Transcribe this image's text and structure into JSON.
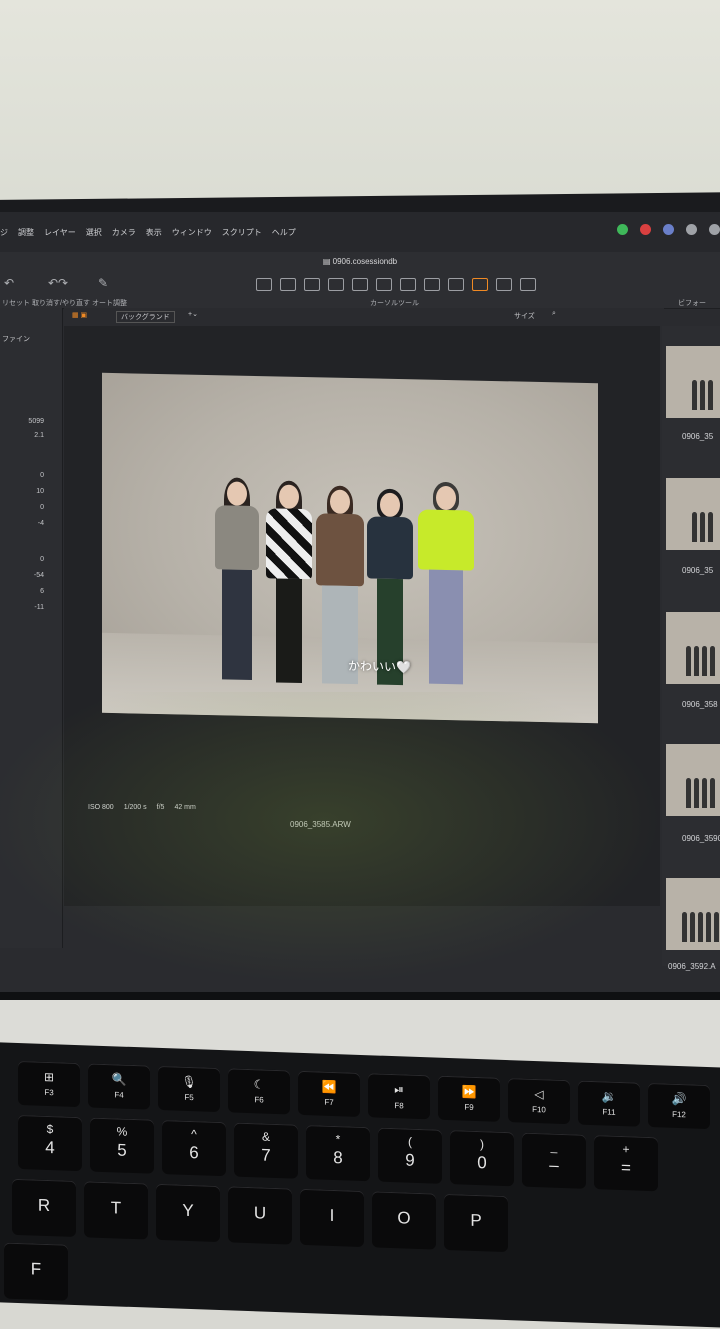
{
  "menu": [
    "ジ",
    "調整",
    "レイヤー",
    "選択",
    "カメラ",
    "表示",
    "ウィンドウ",
    "スクリプト",
    "ヘルプ"
  ],
  "window": {
    "title": "0906.cosessiondb"
  },
  "toolbar": {
    "left_labels": [
      "リセット",
      "取り消す/やり直す",
      "オート調整"
    ],
    "cursor_tools_label": "カーソルツール",
    "viewer_label": "ビフォー"
  },
  "sidebar": {
    "section_label": "ファイン",
    "values": [
      "5099",
      "2.1",
      "0",
      "10",
      "0",
      "-4",
      "0",
      "-54",
      "6",
      "-11"
    ]
  },
  "viewer": {
    "background_select": "バックグランド",
    "size_label": "サイズ",
    "caption": "かわいい🤍",
    "meta": {
      "iso": "ISO 800",
      "shutter": "1/200 s",
      "aperture": "f/5",
      "focal": "42 mm"
    },
    "filename": "0906_3585.ARW"
  },
  "browser": {
    "thumbnails": [
      "0906_35",
      "0906_35",
      "0906_358",
      "0906_3590.",
      "0906_3592.A"
    ]
  },
  "keyboard": {
    "fn_row": [
      {
        "glyph": "⊞",
        "label": "F3"
      },
      {
        "glyph": "🔍",
        "label": "F4"
      },
      {
        "glyph": "🎙",
        "label": "F5"
      },
      {
        "glyph": "☾",
        "label": "F6"
      },
      {
        "glyph": "⏪",
        "label": "F7"
      },
      {
        "glyph": "⏯",
        "label": "F8"
      },
      {
        "glyph": "⏩",
        "label": "F9"
      },
      {
        "glyph": "◁",
        "label": "F10"
      },
      {
        "glyph": "🔉",
        "label": "F11"
      },
      {
        "glyph": "🔊",
        "label": "F12"
      }
    ],
    "num_row": [
      {
        "top": "$",
        "main": "4"
      },
      {
        "top": "%",
        "main": "5"
      },
      {
        "top": "^",
        "main": "6"
      },
      {
        "top": "&",
        "main": "7"
      },
      {
        "top": "*",
        "main": "8"
      },
      {
        "top": "(",
        "main": "9"
      },
      {
        "top": ")",
        "main": "0"
      },
      {
        "top": "_",
        "main": "–"
      },
      {
        "top": "+",
        "main": "="
      }
    ],
    "letter_row": [
      "R",
      "T",
      "Y",
      "U",
      "I",
      "O",
      "P"
    ],
    "bottom_row": [
      "F"
    ]
  },
  "colors": {
    "accent": "#f08a24",
    "screen_bg": "#2a2b2f",
    "photo_bg": "#b9b4ab"
  }
}
